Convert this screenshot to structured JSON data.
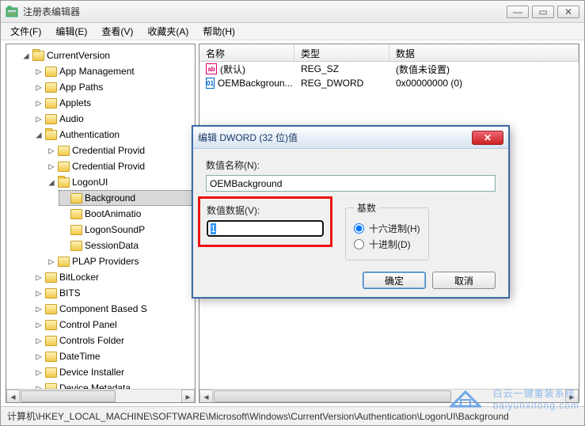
{
  "window": {
    "title": "注册表编辑器",
    "buttons": {
      "min": "—",
      "max": "▭",
      "close": "✕"
    }
  },
  "menu": {
    "file": "文件(F)",
    "edit": "编辑(E)",
    "view": "查看(V)",
    "favorites": "收藏夹(A)",
    "help": "帮助(H)"
  },
  "tree": {
    "root": "CurrentVersion",
    "items": [
      "App Management",
      "App Paths",
      "Applets",
      "Audio"
    ],
    "auth": {
      "label": "Authentication",
      "children": [
        "Credential Provid",
        "Credential Provid"
      ],
      "logonui": {
        "label": "LogonUI",
        "children": [
          "Background",
          "BootAnimatio",
          "LogonSoundP",
          "SessionData"
        ]
      },
      "plap": "PLAP Providers"
    },
    "rest": [
      "BitLocker",
      "BITS",
      "Component Based S",
      "Control Panel",
      "Controls Folder",
      "DateTime",
      "Device Installer",
      "Device Metadata"
    ]
  },
  "listview": {
    "columns": {
      "name": "名称",
      "type": "类型",
      "data": "数据"
    },
    "rows": [
      {
        "icon": "str",
        "name": "(默认)",
        "type": "REG_SZ",
        "data": "(数值未设置)"
      },
      {
        "icon": "dw",
        "name": "OEMBackgroun...",
        "type": "REG_DWORD",
        "data": "0x00000000 (0)"
      }
    ]
  },
  "dialog": {
    "title": "编辑 DWORD (32 位)值",
    "name_label": "数值名称(N):",
    "name_value": "OEMBackground",
    "data_label": "数值数据(V):",
    "data_value": "1",
    "radix_label": "基数",
    "hex_label": "十六进制(H)",
    "dec_label": "十进制(D)",
    "ok": "确定",
    "cancel": "取消"
  },
  "statusbar": "计算机\\HKEY_LOCAL_MACHINE\\SOFTWARE\\Microsoft\\Windows\\CurrentVersion\\Authentication\\LogonUI\\Background",
  "watermark": {
    "line1": "白云一键重装系统",
    "line2": "baiyunxitong.com"
  }
}
